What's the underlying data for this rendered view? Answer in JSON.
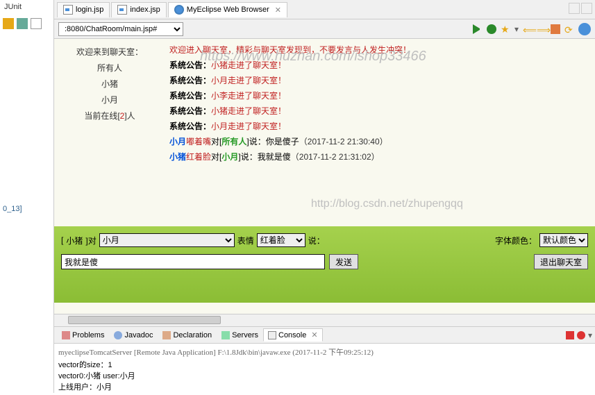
{
  "left": {
    "junit": "JUnit",
    "text13": "0_13]"
  },
  "tabs": [
    {
      "label": "login.jsp",
      "icon": "jsp"
    },
    {
      "label": "index.jsp",
      "icon": "jsp"
    },
    {
      "label": "MyEclipse Web Browser",
      "icon": "globe",
      "active": true,
      "closable": true
    }
  ],
  "addr": {
    "url": ":8080/ChatRoom/main.jsp#"
  },
  "chat": {
    "side": {
      "line0": "欢迎来到聊天室：",
      "line1": "所有人",
      "user1": "小猪",
      "user2": "小月",
      "online_prefix": "当前在线[",
      "online_count": "2",
      "online_suffix": "]人"
    },
    "header_notice": "欢迎进入聊天室，精彩与聊天室发现到，不要发言与人发生冲突！",
    "announce_label": "系统公告：",
    "announcements": [
      "小猪走进了聊天室！",
      "小月走进了聊天室！",
      "小李走进了聊天室！",
      "小猪走进了聊天室！",
      "小月走进了聊天室！"
    ],
    "msgs": [
      {
        "from": "小月",
        "face": "嘟着嘴",
        "face_cls": "face-dudu",
        "to": "所有人",
        "text": "你是傻子",
        "ts": "（2017-11-2 21:30:40）"
      },
      {
        "from": "小猪",
        "face": "红着脸",
        "face_cls": "face-red",
        "to": "小月",
        "text": "我就是傻",
        "ts": "（2017-11-2 21:31:02）"
      }
    ],
    "parts": {
      "dui": "对[",
      "close": "]",
      "shuo": "说："
    },
    "wm1": "https://www.huzhan.com/ishop33466",
    "wm2": "http://blog.csdn.net/zhupengqq"
  },
  "input": {
    "from_open": "[",
    "from": "小猪",
    "from_close_label": "]对",
    "target": "小月",
    "face_label": "表情",
    "face": "红着脸",
    "say_label": "说：",
    "color_label": "字体颜色：",
    "color": "默认颜色",
    "msg_value": "我就是傻",
    "send": "发送",
    "exit": "退出聊天室"
  },
  "bottom": {
    "tabs": {
      "problems": "Problems",
      "javadoc": "Javadoc",
      "declaration": "Declaration",
      "servers": "Servers",
      "console": "Console"
    },
    "header": "myeclipseTomcatServer [Remote Java Application] F:\\1.8Jdk\\bin\\javaw.exe (2017-11-2 下午09:25:12)",
    "lines": [
      "vector的size：1",
      "vector0:小猪 user:小月",
      "上线用户：小月"
    ]
  }
}
